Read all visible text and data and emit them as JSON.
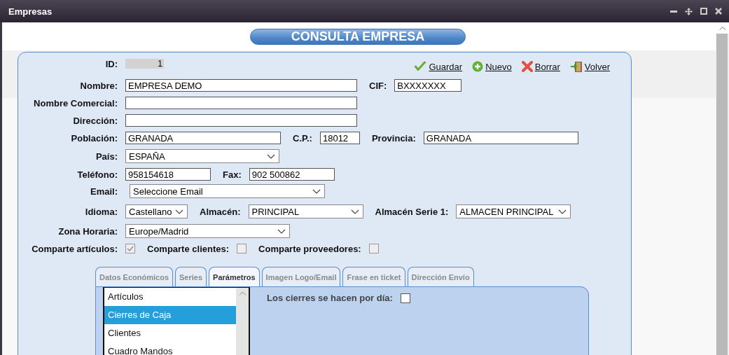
{
  "window": {
    "title": "Empresas"
  },
  "heading": "CONSULTA EMPRESA",
  "actions": [
    {
      "kind": "save",
      "label": "Guardar"
    },
    {
      "kind": "new",
      "label": "Nuevo"
    },
    {
      "kind": "delete",
      "label": "Borrar"
    },
    {
      "kind": "back",
      "label": "Volver"
    }
  ],
  "form": {
    "rows": [
      {
        "fields": [
          {
            "label": "ID:",
            "kind": "id",
            "value": "1"
          }
        ]
      },
      {
        "fields": [
          {
            "label": "Nombre:",
            "kind": "text",
            "value": "EMPRESA DEMO"
          },
          {
            "label": "CIF:",
            "kind": "text",
            "value": "BXXXXXXX"
          }
        ]
      },
      {
        "fields": [
          {
            "label": "Nombre Comercial:",
            "kind": "text"
          }
        ]
      },
      {
        "fields": [
          {
            "label": "Dirección:",
            "kind": "text"
          }
        ]
      },
      {
        "fields": [
          {
            "label": "Población:",
            "kind": "text",
            "value": "GRANADA"
          },
          {
            "label": "C.P.:",
            "kind": "text",
            "value": "18012"
          },
          {
            "label": "Provincia:",
            "kind": "text",
            "value": "GRANADA"
          }
        ]
      },
      {
        "fields": [
          {
            "label": "País:",
            "kind": "select",
            "value": "ESPAÑA"
          }
        ]
      },
      {
        "fields": [
          {
            "label": "Teléfono:",
            "kind": "text",
            "value": "958154618"
          },
          {
            "label": "Fax:",
            "kind": "text",
            "value": "902 500862"
          }
        ]
      },
      {
        "fields": [
          {
            "label": "Email:",
            "kind": "select",
            "value": "Seleccione Email"
          }
        ]
      },
      {
        "fields": [
          {
            "label": "Idioma:",
            "kind": "select",
            "value": "Castellano"
          },
          {
            "label": "Almacén:",
            "kind": "select",
            "value": "PRINCIPAL"
          },
          {
            "label": "Almacén Serie 1:",
            "kind": "select",
            "value": "ALMACEN PRINCIPAL"
          }
        ]
      },
      {
        "fields": [
          {
            "label": "Zona Horaria:",
            "kind": "select",
            "value": "Europe/Madrid"
          }
        ]
      },
      {
        "fields": [
          {
            "label": "Comparte artículos:",
            "kind": "checkbox",
            "checked": true
          },
          {
            "label": "Comparte clientes:",
            "kind": "checkbox",
            "checked": false
          },
          {
            "label": "Comparte proveedores:",
            "kind": "checkbox",
            "checked": false
          }
        ]
      }
    ]
  },
  "tabs": [
    {
      "label": "Datos Económicos",
      "selected": false
    },
    {
      "label": "Series",
      "selected": false
    },
    {
      "label": "Parámetros",
      "selected": true
    },
    {
      "label": "Imagen Logo/Email",
      "selected": false
    },
    {
      "label": "Frase en ticket",
      "selected": false
    },
    {
      "label": "Dirección Envío",
      "selected": false
    }
  ],
  "parameters": {
    "list": [
      {
        "label": "Artículos",
        "selected": false
      },
      {
        "label": "Cierres de Caja",
        "selected": true
      },
      {
        "label": "Clientes",
        "selected": false
      },
      {
        "label": "Cuadro Mandos",
        "selected": false
      }
    ],
    "option": {
      "label": "Los cierres se hacen por día:",
      "checked": false
    }
  }
}
